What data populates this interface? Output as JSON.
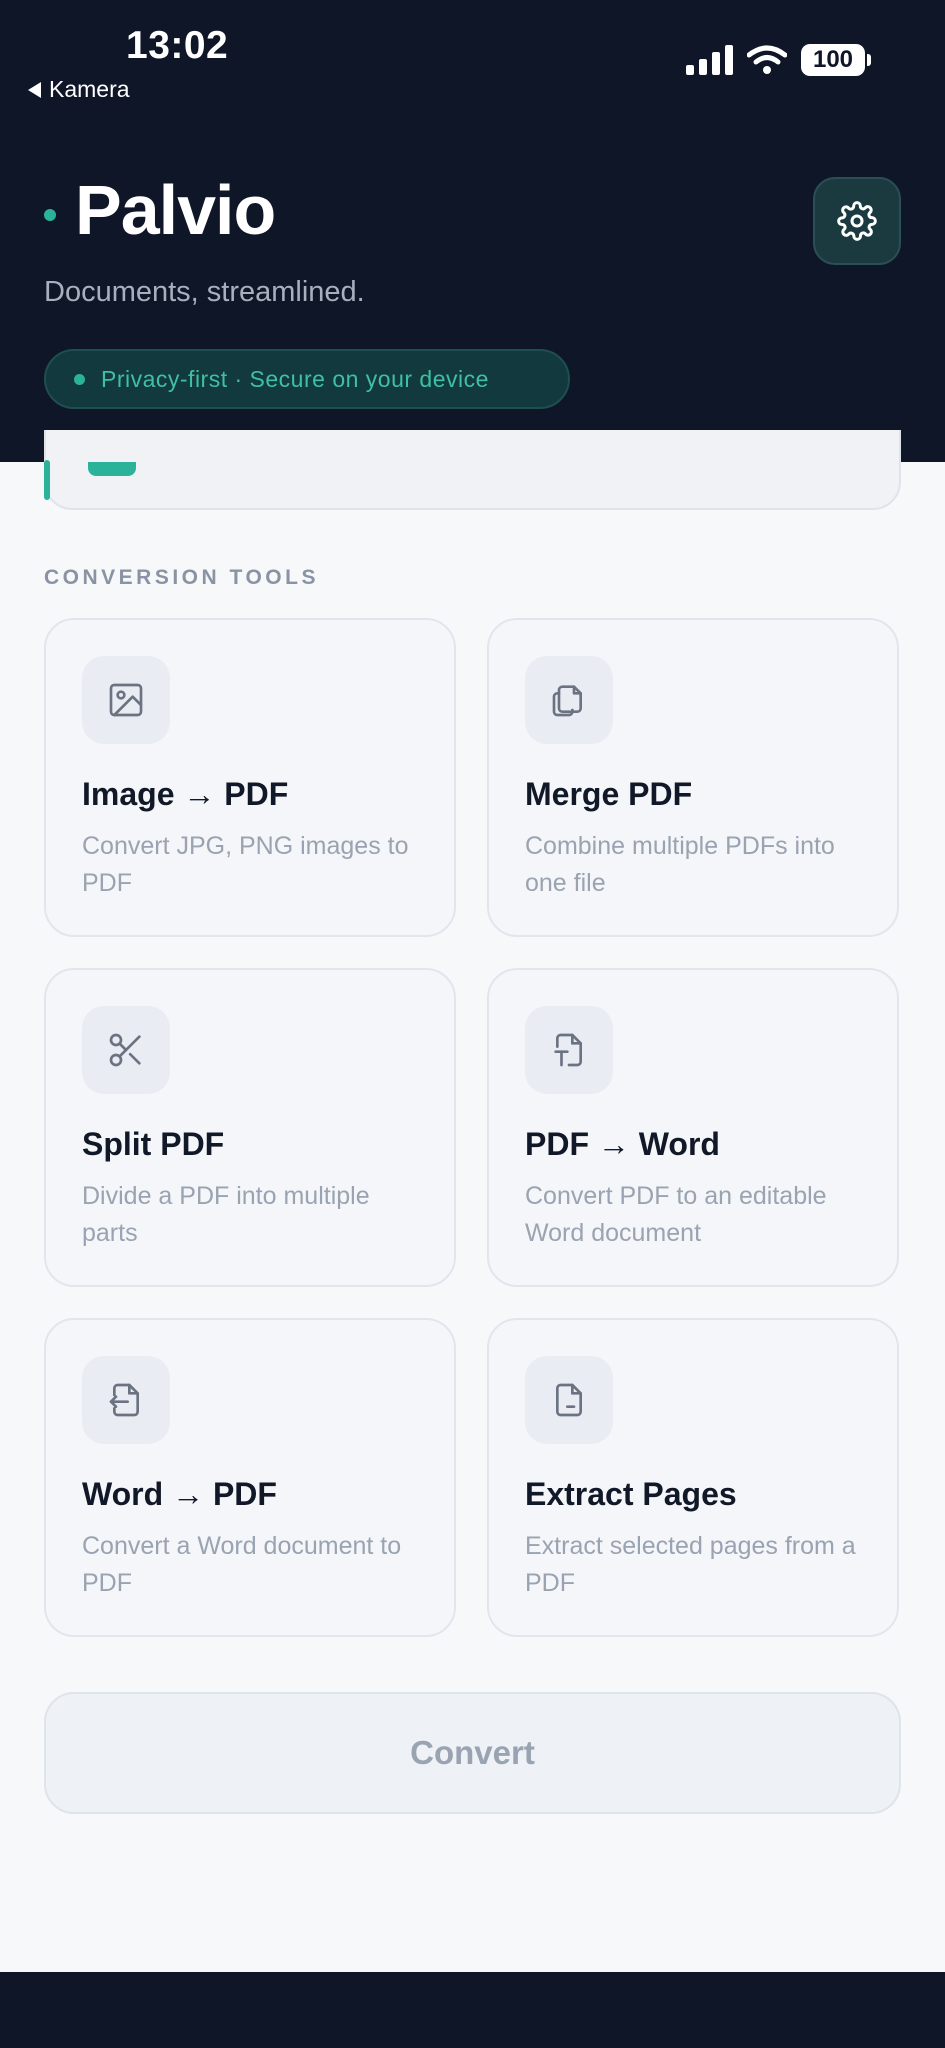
{
  "status_bar": {
    "time": "13:02",
    "back_label": "Kamera",
    "battery": "100"
  },
  "header": {
    "title": "Palvio",
    "tagline": "Documents, streamlined.",
    "privacy_badge": "Privacy-first · Secure on your device"
  },
  "section_title": "CONVERSION TOOLS",
  "tools": [
    {
      "title": "Image → PDF",
      "desc": "Convert JPG, PNG images to PDF",
      "icon": "image-icon"
    },
    {
      "title": "Merge PDF",
      "desc": "Combine multiple PDFs into one file",
      "icon": "copy-files-icon"
    },
    {
      "title": "Split PDF",
      "desc": "Divide a PDF into multiple parts",
      "icon": "scissors-icon"
    },
    {
      "title": "PDF → Word",
      "desc": "Convert PDF to an editable Word document",
      "icon": "text-file-icon"
    },
    {
      "title": "Word → PDF",
      "desc": "Convert a Word document to PDF",
      "icon": "file-import-icon"
    },
    {
      "title": "Extract Pages",
      "desc": "Extract selected pages from a PDF",
      "icon": "file-icon"
    }
  ],
  "convert_label": "Convert",
  "colors": {
    "accent": "#2bb39a",
    "header_bg": "#0e1628",
    "page_bg": "#f7f8fa"
  }
}
